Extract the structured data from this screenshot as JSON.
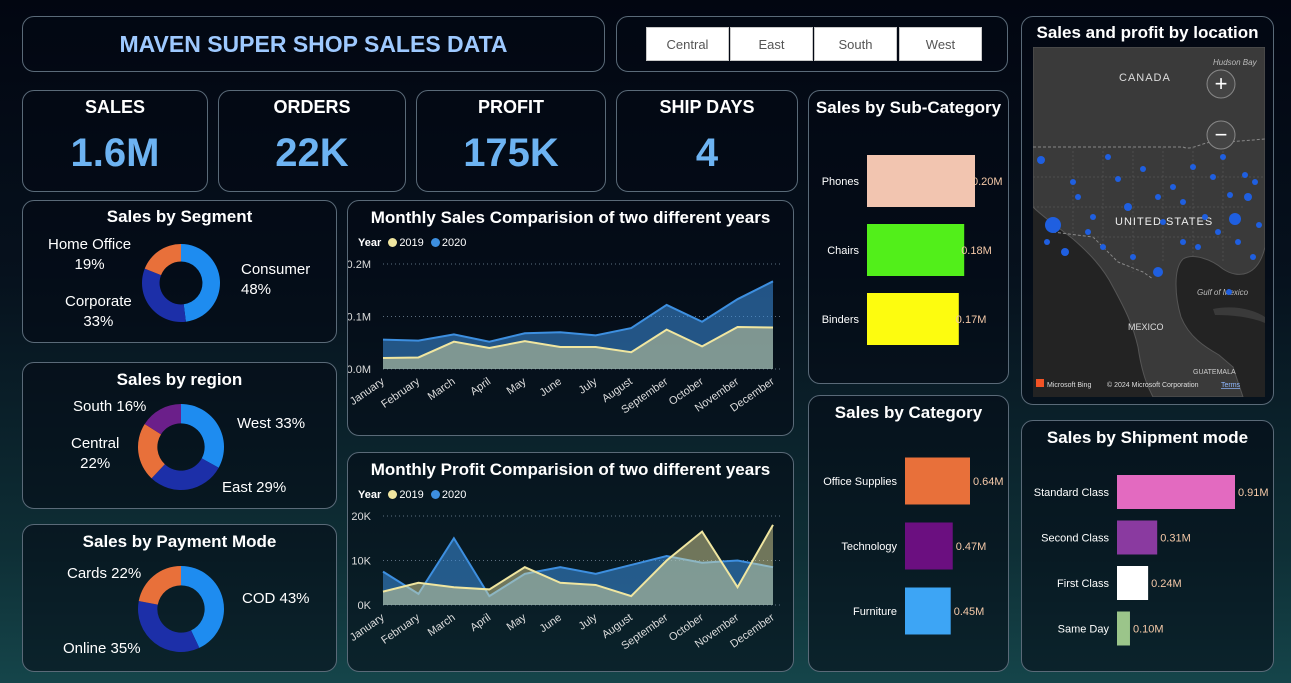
{
  "title": "MAVEN SUPER SHOP SALES DATA",
  "slicer": [
    "Central",
    "East",
    "South",
    "West"
  ],
  "kpis": [
    {
      "label": "SALES",
      "value": "1.6M"
    },
    {
      "label": "ORDERS",
      "value": "22K"
    },
    {
      "label": "PROFIT",
      "value": "175K"
    },
    {
      "label": "SHIP DAYS",
      "value": "4"
    }
  ],
  "segment": {
    "title": "Sales by Segment",
    "l1": "Home Office",
    "l2": "19%",
    "l3": "Corporate",
    "l4": "33%",
    "l5": "Consumer",
    "l6": "48%"
  },
  "region": {
    "title": "Sales by region",
    "south": "South 16%",
    "west": "West 33%",
    "l1": "Central",
    "l2": "22%",
    "east": "East 29%"
  },
  "payment": {
    "title": "Sales by Payment Mode",
    "cards": "Cards 22%",
    "cod": "COD 43%",
    "online": "Online 35%"
  },
  "monthly_sales_title": "Monthly Sales Comparision of two different years",
  "monthly_profit_title": "Monthly Profit Comparision of two different years",
  "legend": {
    "label": "Year",
    "y2019": "2019",
    "y2020": "2020"
  },
  "subcat_title": "Sales by Sub-Category",
  "category_title": "Sales by Category",
  "shipment_title": "Sales by Shipment mode",
  "map": {
    "title": "Sales and profit by location",
    "canada": "CANADA",
    "us": "UNITED STATES",
    "mexico": "MEXICO",
    "gulf": "Gulf of Mexico",
    "guatemala": "GUATEMALA",
    "bing": "Microsoft Bing",
    "copyright": "© 2024 Microsoft Corporation",
    "terms": "Terms",
    "hudson": "Hudson Bay",
    "zoom_in": "+",
    "zoom_out": "−"
  },
  "colors": {
    "y2019": "#f0e6a0",
    "y2020": "#3d8fe0",
    "accent": "#1a8cff"
  },
  "chart_data": [
    {
      "type": "pie",
      "title": "Sales by Segment",
      "labels": [
        "Consumer",
        "Corporate",
        "Home Office"
      ],
      "values": [
        48,
        33,
        19
      ],
      "colors": [
        "#1e8cf0",
        "#1c2fa8",
        "#e8703a"
      ]
    },
    {
      "type": "pie",
      "title": "Sales by region",
      "labels": [
        "West",
        "East",
        "Central",
        "South"
      ],
      "values": [
        33,
        29,
        22,
        16
      ],
      "colors": [
        "#1e8cf0",
        "#1c2fa8",
        "#e8703a",
        "#6b1f8a"
      ]
    },
    {
      "type": "pie",
      "title": "Sales by Payment Mode",
      "labels": [
        "COD",
        "Online",
        "Cards"
      ],
      "values": [
        43,
        35,
        22
      ],
      "colors": [
        "#1e8cf0",
        "#1c2fa8",
        "#e8703a"
      ]
    },
    {
      "type": "area",
      "title": "Monthly Sales Comparision of two different years",
      "categories": [
        "January",
        "February",
        "March",
        "April",
        "May",
        "June",
        "July",
        "August",
        "September",
        "October",
        "November",
        "December"
      ],
      "yticks": [
        "0.0M",
        "0.1M",
        "0.2M"
      ],
      "ylim": [
        0,
        0.2
      ],
      "series": [
        {
          "name": "2019",
          "values": [
            0.021,
            0.022,
            0.052,
            0.04,
            0.053,
            0.042,
            0.042,
            0.032,
            0.075,
            0.043,
            0.08,
            0.079
          ]
        },
        {
          "name": "2020",
          "values": [
            0.056,
            0.054,
            0.066,
            0.052,
            0.068,
            0.07,
            0.064,
            0.078,
            0.122,
            0.09,
            0.133,
            0.167
          ]
        }
      ]
    },
    {
      "type": "area",
      "title": "Monthly Profit Comparision of two different years",
      "categories": [
        "January",
        "February",
        "March",
        "April",
        "May",
        "June",
        "July",
        "August",
        "September",
        "October",
        "November",
        "December"
      ],
      "yticks": [
        "0K",
        "10K",
        "20K"
      ],
      "ylim": [
        0,
        20
      ],
      "series": [
        {
          "name": "2019",
          "values": [
            3,
            5,
            4,
            3.5,
            8.5,
            5,
            4.5,
            2,
            10,
            16.5,
            4,
            18
          ]
        },
        {
          "name": "2020",
          "values": [
            7.5,
            2.5,
            15,
            2,
            7,
            8.5,
            7,
            9,
            11,
            9.5,
            10,
            8.5
          ]
        }
      ]
    },
    {
      "type": "bar",
      "title": "Sales by Sub-Category",
      "categories": [
        "Phones",
        "Chairs",
        "Binders"
      ],
      "values": [
        0.2,
        0.18,
        0.17
      ],
      "labels": [
        "0.20M",
        "0.18M",
        "0.17M"
      ],
      "colors": [
        "#f2c5b0",
        "#52ef1a",
        "#fdfc0f"
      ]
    },
    {
      "type": "bar",
      "title": "Sales by Category",
      "categories": [
        "Office Supplies",
        "Technology",
        "Furniture"
      ],
      "values": [
        0.64,
        0.47,
        0.45
      ],
      "labels": [
        "0.64M",
        "0.47M",
        "0.45M"
      ],
      "colors": [
        "#e8703a",
        "#6b0f80",
        "#3da5f5"
      ]
    },
    {
      "type": "bar",
      "title": "Sales by Shipment mode",
      "categories": [
        "Standard Class",
        "Second Class",
        "First Class",
        "Same Day"
      ],
      "values": [
        0.91,
        0.31,
        0.24,
        0.1
      ],
      "labels": [
        "0.91M",
        "0.31M",
        "0.24M",
        "0.10M"
      ],
      "colors": [
        "#e36ac0",
        "#8a3aa0",
        "#ffffff",
        "#9bc58a"
      ]
    }
  ]
}
